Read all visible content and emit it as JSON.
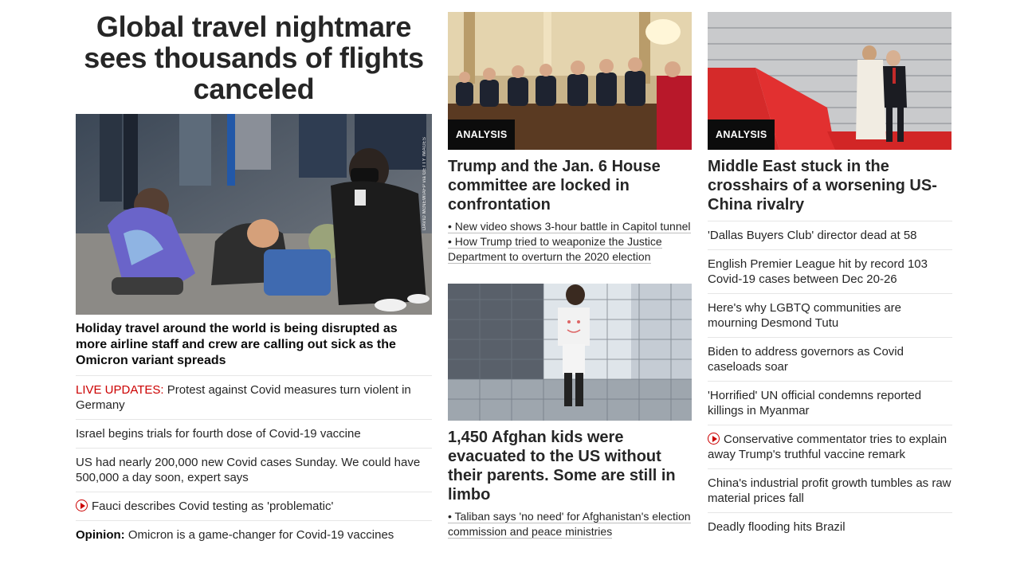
{
  "col1": {
    "headline": "Global travel nightmare sees thousands of flights canceled",
    "photo_credit": "DAVID McNEW/AFP via GETTY IMAGES",
    "sub_headline": "Holiday travel around the world is being disrupted as more airline staff and crew are calling out sick as the Omicron variant spreads",
    "items": [
      {
        "prefix": "LIVE UPDATES:",
        "text": " Protest against Covid measures turn violent in Germany"
      },
      {
        "text": "Israel begins trials for fourth dose of Covid-19 vaccine"
      },
      {
        "text": "US had nearly 200,000 new Covid cases Sunday. We could have 500,000 a day soon, expert says"
      },
      {
        "text": "Fauci describes Covid testing as 'problematic'",
        "video": true
      },
      {
        "prefix": "Opinion:",
        "text": " Omicron is a game-changer for Covid-19 vaccines"
      }
    ]
  },
  "col2": {
    "card1": {
      "badge": "ANALYSIS",
      "title": "Trump and the Jan. 6 House committee are locked in confrontation",
      "bullets": [
        "• New video shows 3-hour battle in Capitol tunnel",
        "• How Trump tried to weaponize the Justice Department to overturn the 2020 election"
      ]
    },
    "card2": {
      "title": "1,450 Afghan kids were evacuated to the US without their parents. Some are still in limbo",
      "bullets": [
        "• Taliban says 'no need' for Afghanistan's election commission and peace ministries"
      ]
    }
  },
  "col3": {
    "card": {
      "badge": "ANALYSIS",
      "title": "Middle East stuck in the crosshairs of a worsening US-China rivalry"
    },
    "items": [
      {
        "text": "'Dallas Buyers Club' director dead at 58"
      },
      {
        "text": "English Premier League hit by record 103 Covid-19 cases between Dec 20-26"
      },
      {
        "text": "Here's why LGBTQ communities are mourning Desmond Tutu"
      },
      {
        "text": "Biden to address governors as Covid caseloads soar"
      },
      {
        "text": "'Horrified' UN official condemns reported killings in Myanmar"
      },
      {
        "text": "Conservative commentator tries to explain away Trump's truthful vaccine remark",
        "video": true
      },
      {
        "text": "China's industrial profit growth tumbles as raw material prices fall"
      },
      {
        "text": "Deadly flooding hits Brazil"
      }
    ]
  },
  "colors": {
    "accent_red": "#cc0000",
    "text": "#262626",
    "divider": "#e6e6e6",
    "badge_bg": "#0c0c0c"
  }
}
